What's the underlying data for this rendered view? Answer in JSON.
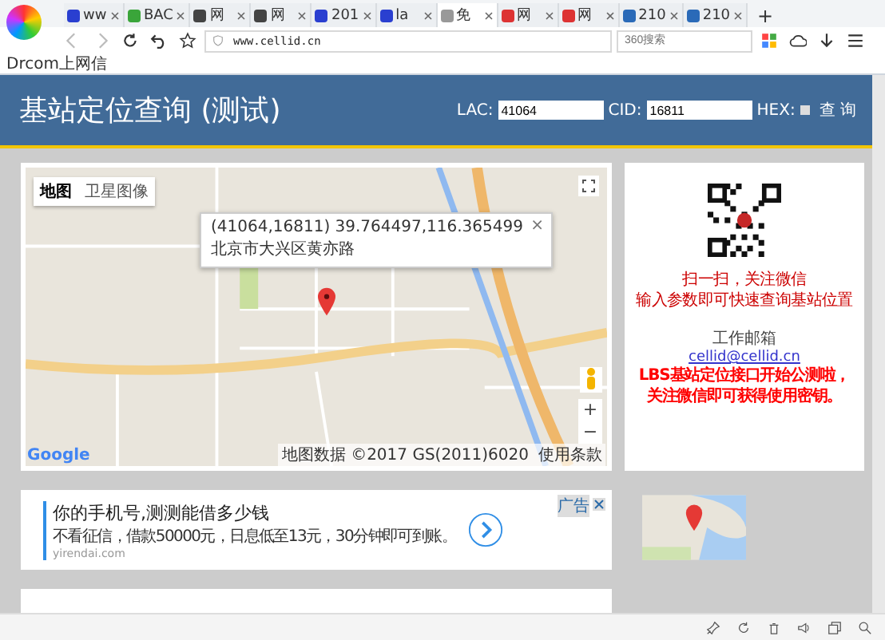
{
  "browser": {
    "tabs": [
      {
        "label": "ww",
        "kind": "paw",
        "selected": false
      },
      {
        "label": "BAC",
        "kind": "ring",
        "selected": false
      },
      {
        "label": "网",
        "kind": "alt",
        "selected": false
      },
      {
        "label": "网",
        "kind": "alt",
        "selected": false
      },
      {
        "label": "201",
        "kind": "paw",
        "selected": false
      },
      {
        "label": "la",
        "kind": "paw",
        "selected": false
      },
      {
        "label": "免",
        "kind": "page",
        "selected": true
      },
      {
        "label": "网",
        "kind": "house",
        "selected": false
      },
      {
        "label": "网",
        "kind": "house",
        "selected": false
      },
      {
        "label": "210",
        "kind": "monitor",
        "selected": false
      },
      {
        "label": "210",
        "kind": "monitor",
        "selected": false
      }
    ],
    "new_tab": "+",
    "address": "www.cellid.cn",
    "search_placeholder": "360搜索",
    "bookmarks": [
      "Drcom上网信"
    ]
  },
  "header": {
    "title": "基站定位查询 (测试)",
    "lac_label": "LAC:",
    "lac": "41064",
    "cid_label": "CID:",
    "cid": "16811",
    "hex_label": "HEX:",
    "hex_checked": false,
    "query": "查 询"
  },
  "map": {
    "types": [
      {
        "label": "地图",
        "selected": true
      },
      {
        "label": "卫星图像",
        "selected": false
      }
    ],
    "info_lines": [
      "(41064,16811) 39.764497,116.365499",
      "北京市大兴区黄亦路"
    ],
    "close": "×",
    "zoom_in": "+",
    "zoom_out": "−",
    "logo": "Google",
    "attribution": "地图数据 ©2017 GS(2011)6020",
    "terms": "使用条款"
  },
  "side": {
    "scan_lines": [
      "扫一扫，关注微信",
      "输入参数即可快速查询基站位置"
    ],
    "email_label": "工作邮箱",
    "email": "cellid@cellid.cn",
    "promo_lines": [
      "LBS基站定位接口开始公测啦，",
      "关注微信即可获得使用密钥。"
    ]
  },
  "ad": {
    "title": "你的手机号,测测能借多少钱",
    "desc": "不看征信，借款50000元，日息低至13元，30分钟即可到账。",
    "domain": "yirendai.com",
    "badge": "广告"
  }
}
